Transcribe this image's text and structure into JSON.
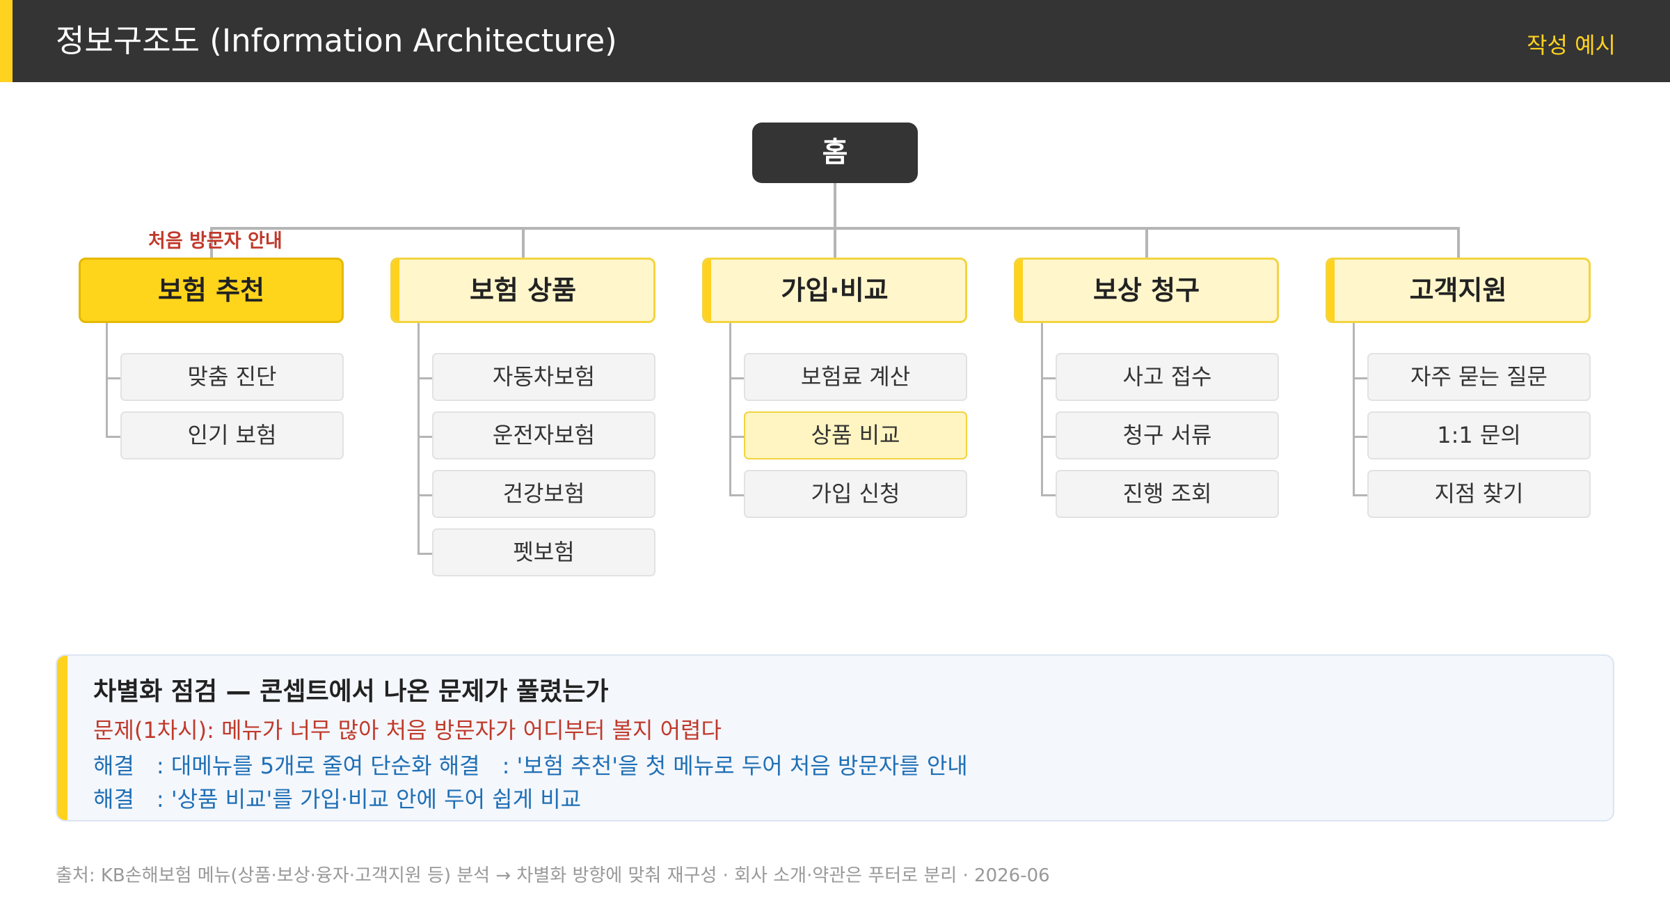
{
  "header": {
    "title": "정보구조도 (Information Architecture)",
    "badge": "작성 예시"
  },
  "colors": {
    "accent": "#FFD21F",
    "dark": "#343434",
    "category_bg": "#FFF6CC",
    "problem": "#C0392B",
    "solution": "#1F6FB5"
  },
  "tree": {
    "root": "홈",
    "categories": [
      {
        "label": "보험 추천",
        "note": "처음 방문자 안내",
        "highlighted": true,
        "items": [
          {
            "label": "맞춤 진단"
          },
          {
            "label": "인기 보험"
          }
        ]
      },
      {
        "label": "보험 상품",
        "items": [
          {
            "label": "자동차보험"
          },
          {
            "label": "운전자보험"
          },
          {
            "label": "건강보험"
          },
          {
            "label": "펫보험"
          }
        ]
      },
      {
        "label": "가입·비교",
        "items": [
          {
            "label": "보험료 계산"
          },
          {
            "label": "상품 비교",
            "highlighted": true
          },
          {
            "label": "가입 신청"
          }
        ]
      },
      {
        "label": "보상 청구",
        "items": [
          {
            "label": "사고 접수"
          },
          {
            "label": "청구 서류"
          },
          {
            "label": "진행 조회"
          }
        ]
      },
      {
        "label": "고객지원",
        "items": [
          {
            "label": "자주 묻는 질문"
          },
          {
            "label": "1:1 문의"
          },
          {
            "label": "지점 찾기"
          }
        ]
      }
    ]
  },
  "check": {
    "title": "차별화 점검 — 콘셉트에서 나온 문제가 풀렸는가",
    "problem": "문제(1차시): 메뉴가 너무 많아 처음 방문자가 어디부터 볼지 어렵다",
    "solutions": [
      "해결　: 대메뉴를 5개로 줄여 단순화 해결　: '보험 추천'을 첫 메뉴로 두어 처음 방문자를 안내",
      "해결　: '상품 비교'를 가입·비교 안에 두어 쉽게 비교"
    ]
  },
  "footer": "출처: KB손해보험 메뉴(상품·보상·융자·고객지원 등) 분석 → 차별화 방향에 맞춰 재구성 · 회사 소개·약관은 푸터로 분리 · 2026-06"
}
